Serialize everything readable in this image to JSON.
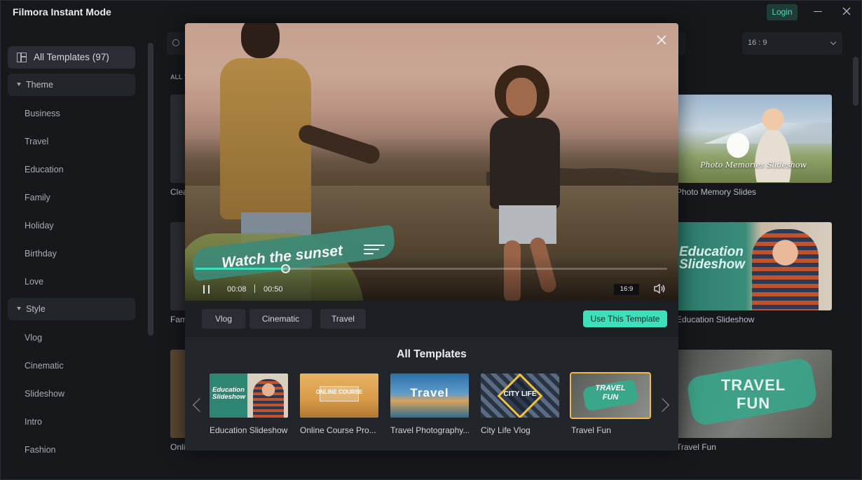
{
  "app": {
    "title": "Filmora Instant Mode",
    "login_label": "Login"
  },
  "sidebar": {
    "all_templates_label": "All Templates (97)",
    "groups": {
      "theme": {
        "label": "Theme",
        "items": [
          "Business",
          "Travel",
          "Education",
          "Family",
          "Holiday",
          "Birthday",
          "Love"
        ]
      },
      "style": {
        "label": "Style",
        "items": [
          "Vlog",
          "Cinematic",
          "Slideshow",
          "Intro",
          "Fashion"
        ]
      }
    }
  },
  "toolbar": {
    "aspect_ratio_value": "16 : 9"
  },
  "background_grid": {
    "section_heading": "ALL T",
    "left_labels": [
      "Clea",
      "Fam",
      "Onli"
    ],
    "right_cards": [
      {
        "label": "Photo Memory Slides",
        "overlay_text": "Photo Memories Slideshow"
      },
      {
        "label": "Education Slideshow",
        "overlay_text": "Education Slideshow"
      },
      {
        "label": "Travel Fun",
        "overlay_text": "TRAVEL FUN"
      }
    ]
  },
  "preview_modal": {
    "caption_text": "Watch the sunset",
    "time_current": "00:08",
    "time_total": "00:50",
    "progress": 0.19,
    "aspect_badge": "16:9",
    "tags": [
      "Vlog",
      "Cinematic",
      "Travel"
    ],
    "use_button_label": "Use This Template",
    "strip_title": "All Templates",
    "templates": [
      {
        "label": "Education Slideshow",
        "thumb_text": "Education Slideshow"
      },
      {
        "label": "Online Course Pro...",
        "thumb_text": "ONLINE COURSE"
      },
      {
        "label": "Travel Photography...",
        "thumb_text": "Travel"
      },
      {
        "label": "City Life Vlog",
        "thumb_text": "CITY LIFE"
      },
      {
        "label": "Travel Fun",
        "thumb_text": "TRAVEL FUN"
      }
    ],
    "selected_template_index": 4
  },
  "colors": {
    "accent": "#3ee0bb",
    "selection_outline": "#f2b94c",
    "background": "#16181c"
  },
  "icons": {
    "close": "close-icon",
    "pause": "pause-icon",
    "volume": "volume-icon",
    "grid": "grid-icon",
    "prev": "chevron-left-icon",
    "next": "chevron-right-icon"
  }
}
